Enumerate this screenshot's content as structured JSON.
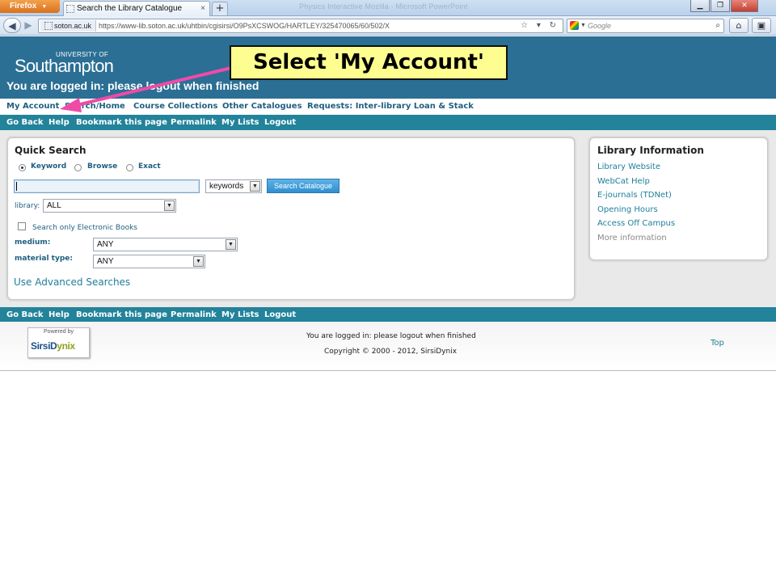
{
  "browser": {
    "app_button": "Firefox",
    "tab_title": "Search the Library Catalogue",
    "new_tab": "+",
    "ghost_title": "Physics Interactive Mozilla · Microsoft PowerPoint",
    "url_site": "soton.ac.uk",
    "url": "https://www-lib.soton.ac.uk/uhtbin/cgisirsi/O9PsXCSWOG/HARTLEY/325470065/60/502/X",
    "search_placeholder": "Google"
  },
  "header": {
    "logo_small": "UNIVERSITY OF",
    "logo_big": "Southampton",
    "logged_in": "You are logged in: please logout when finished"
  },
  "menu_primary": [
    "My Account",
    "Search/Home",
    "Course Collections",
    "Other Catalogues",
    "Requests: Inter-library Loan & Stack"
  ],
  "menu_secondary": [
    "Go Back",
    "Help",
    "Bookmark this page",
    "Permalink",
    "My Lists",
    "Logout"
  ],
  "quick_search": {
    "title": "Quick Search",
    "modes": [
      "Keyword",
      "Browse",
      "Exact"
    ],
    "selected_mode": "Keyword",
    "query_value": "",
    "search_type": "keywords",
    "search_button": "Search Catalogue",
    "library_label": "library:",
    "library_value": "ALL",
    "ebooks_label": "Search only Electronic Books",
    "ebooks_checked": false,
    "medium_label": "medium:",
    "medium_value": "ANY",
    "material_label": "material type:",
    "material_value": "ANY",
    "advanced_link": "Use Advanced Searches"
  },
  "library_info": {
    "title": "Library Information",
    "links": [
      "Library Website",
      "WebCat Help",
      "E-journals (TDNet)",
      "Opening Hours",
      "Access Off Campus"
    ],
    "more": "More information"
  },
  "footer": {
    "powered_by": "Powered by",
    "sirsi_a": "SirsiD",
    "sirsi_b": "ynix",
    "logged_in": "You are logged in: please logout when finished",
    "copyright": "Copyright © 2000 - 2012, SirsiDynix",
    "top_link": "Top"
  },
  "annotation": {
    "callout_text": "Select 'My Account'",
    "arrow_color": "#f04aa8"
  },
  "colors": {
    "header_bg": "#2b6f94",
    "nav_bar_bg": "#22839b",
    "link": "#1f7e9a",
    "callout_bg": "#fdfd90"
  }
}
